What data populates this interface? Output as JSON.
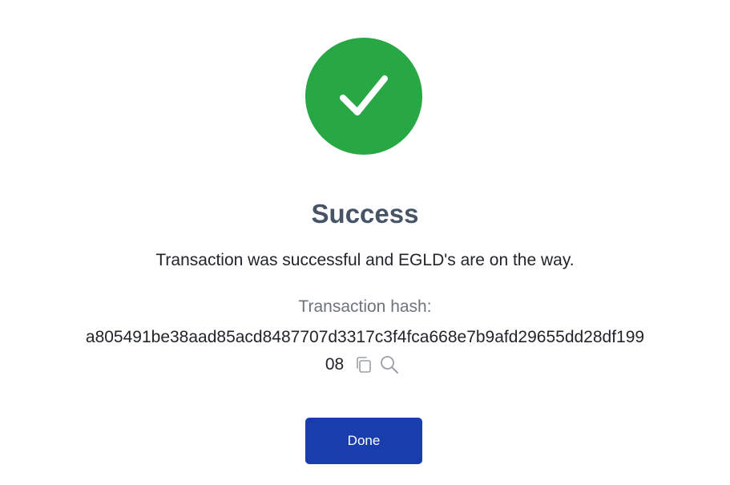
{
  "status": {
    "title": "Success",
    "message": "Transaction was successful and EGLD's are on the way.",
    "icon": "check-icon",
    "color": "#28a745"
  },
  "transaction": {
    "hash_label": "Transaction hash:",
    "hash_line1": "a805491be38aad85acd8487707d3317c3f4fca668e7b9afd29655dd28df199",
    "hash_line2": "08",
    "copy_icon": "copy-icon",
    "search_icon": "search-icon"
  },
  "actions": {
    "done_label": "Done",
    "done_color": "#1a3dae"
  }
}
